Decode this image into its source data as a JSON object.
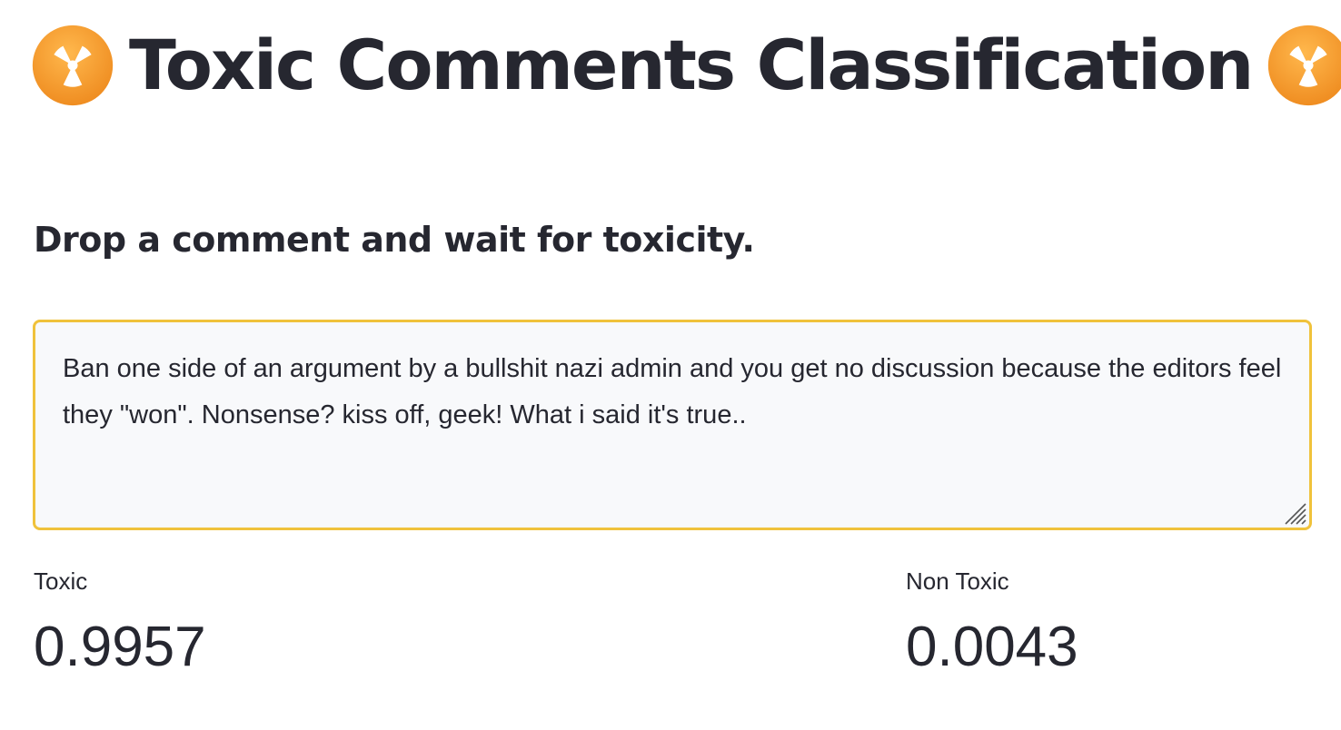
{
  "header": {
    "title": "Toxic Comments Classification",
    "left_icon": "radioactive-icon",
    "right_icon": "radioactive-icon"
  },
  "subtitle": "Drop a comment and wait for toxicity.",
  "comment_input": {
    "value": "Ban one side of an argument by a bullshit nazi admin and you get no discussion because the editors feel they \"won\". Nonsense? kiss off, geek! What i said it's true..",
    "focus_border_color": "#f0c23b"
  },
  "metrics": {
    "toxic": {
      "label": "Toxic",
      "value": "0.9957"
    },
    "non_toxic": {
      "label": "Non Toxic",
      "value": "0.0043"
    }
  },
  "colors": {
    "text": "#262730",
    "emoji_orange": "#f39a2b",
    "input_background": "#f8f9fb"
  }
}
